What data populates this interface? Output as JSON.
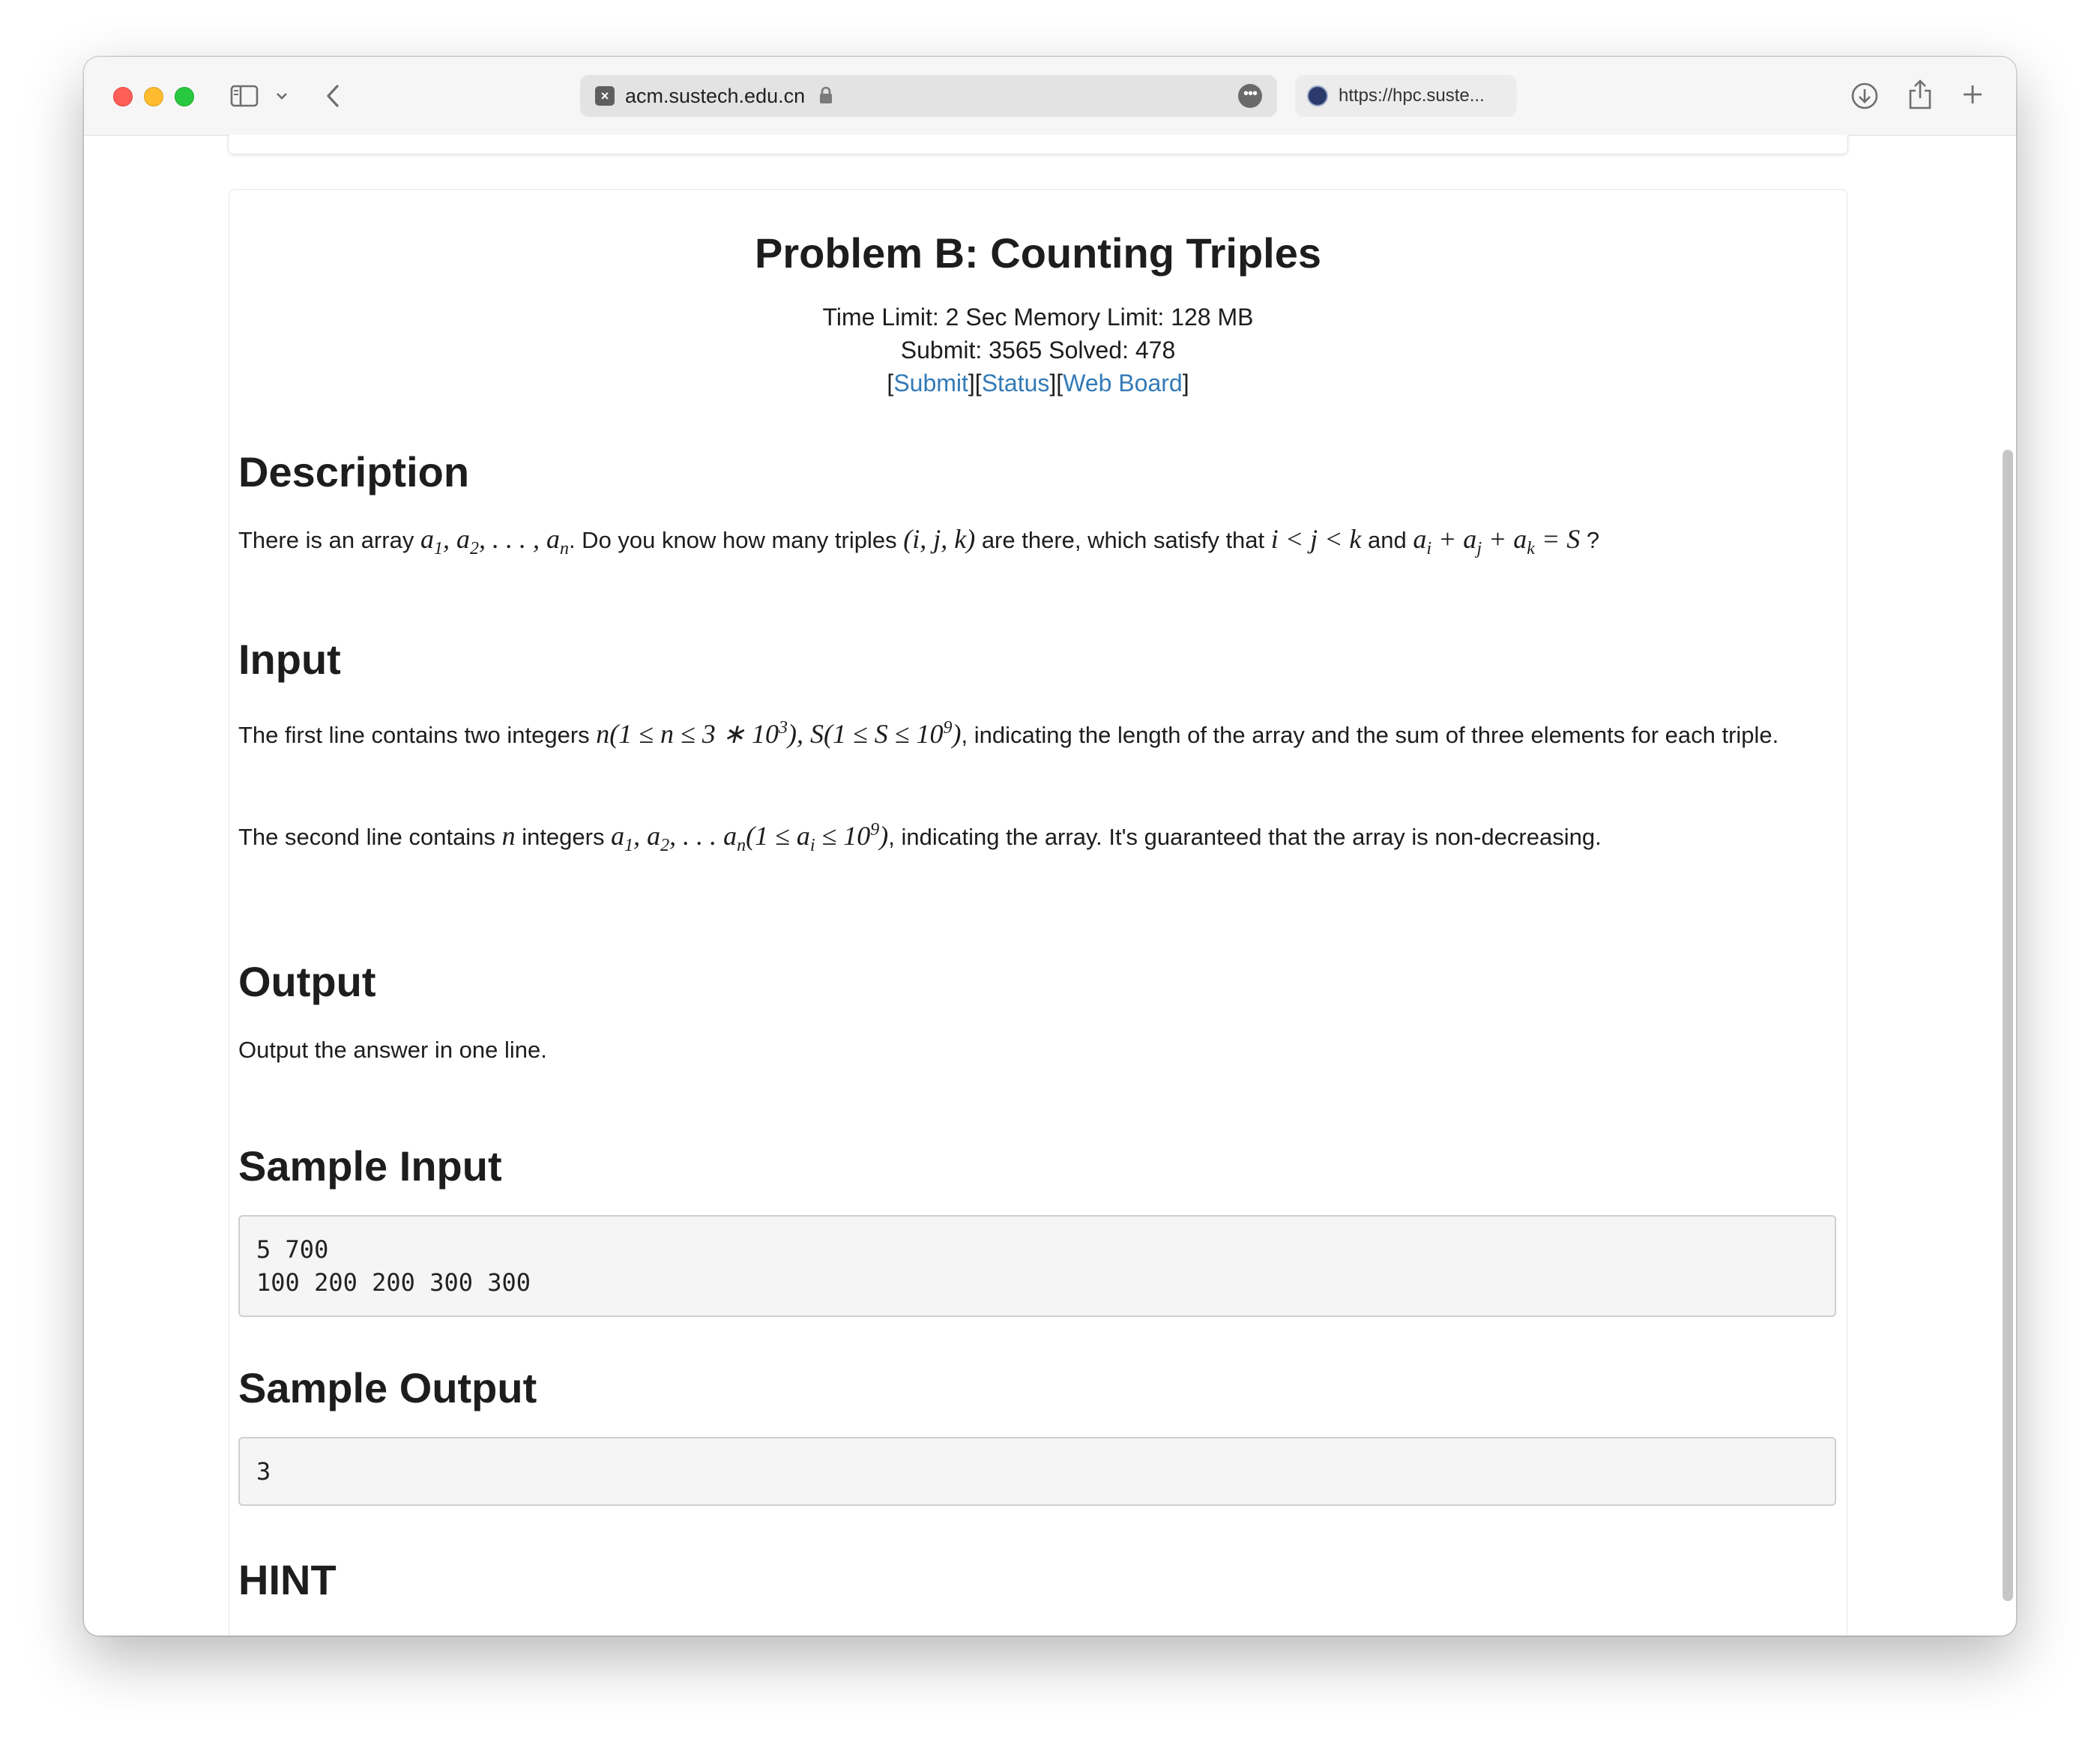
{
  "browser": {
    "url": "acm.sustech.edu.cn",
    "second_tab": "https://hpc.suste..."
  },
  "problem": {
    "title": "Problem B: Counting Triples",
    "limits": "Time Limit: 2 Sec  Memory Limit: 128 MB",
    "stats": "Submit: 3565  Solved: 478",
    "links": [
      "Submit",
      "Status",
      "Web Board"
    ]
  },
  "sections": {
    "description_heading": "Description",
    "input_heading": "Input",
    "output_heading": "Output",
    "sample_input_heading": "Sample Input",
    "sample_output_heading": "Sample Output",
    "hint_heading": "HINT"
  },
  "text": {
    "desc_a": "There is an array",
    "desc_b": ". Do you know how many triples",
    "desc_c": "are there, which satisfy that",
    "desc_d": "and",
    "desc_e": "?",
    "input1_a": "The first line contains two integers",
    "input1_b": ", indicating the length of the array and the sum of three elements for each triple.",
    "input2_a": "The second line contains",
    "input2_b": "integers",
    "input2_c": ", indicating the array. It's guaranteed that the array is non-decreasing.",
    "output": "Output the answer in one line."
  },
  "samples": {
    "input": "5 700\n100 200 200 300 300",
    "output": "3"
  },
  "colors": {
    "link": "#337ab7",
    "code_bg": "#f5f5f5"
  }
}
